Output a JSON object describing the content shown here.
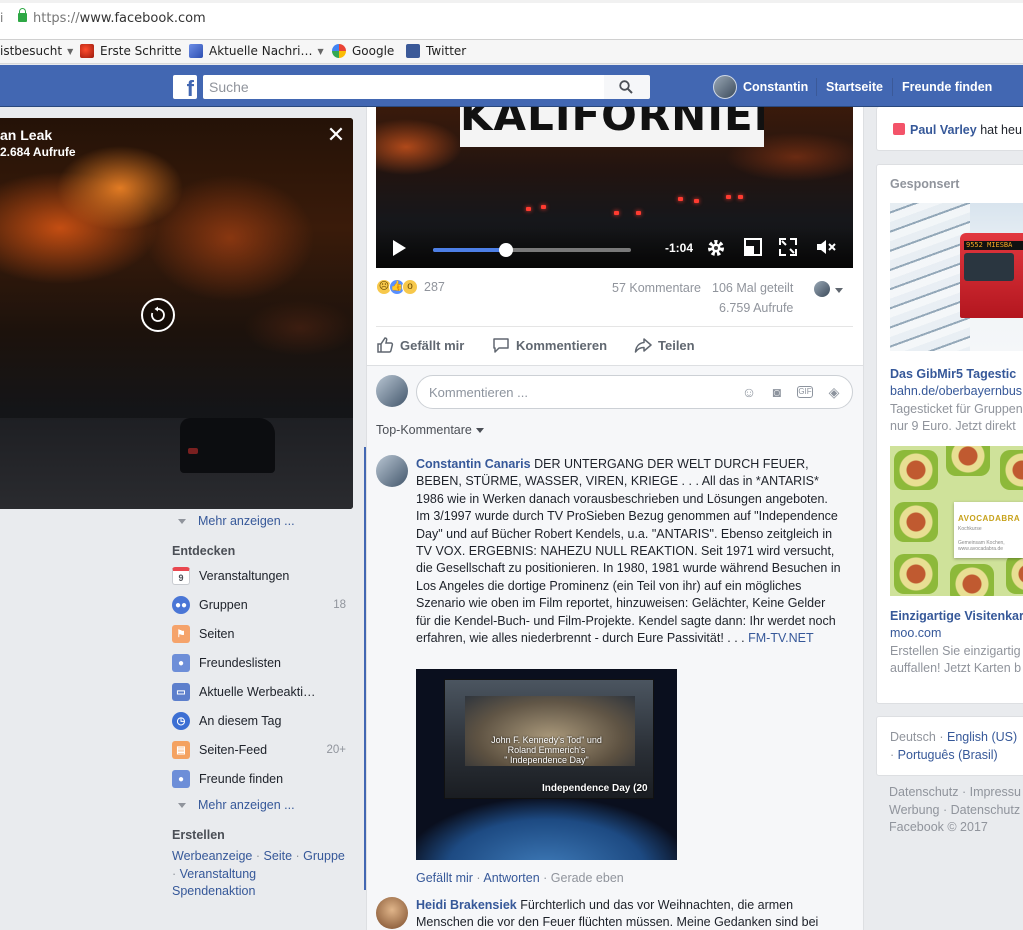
{
  "browser": {
    "url_prefix": "https://",
    "url_host": "www.facebook.com",
    "bookmarks": [
      {
        "label": "istbesucht",
        "caret": "▼"
      },
      {
        "label": "Erste Schritte"
      },
      {
        "label": "Aktuelle Nachri…",
        "caret": "▼"
      },
      {
        "label": "Google"
      },
      {
        "label": "Twitter"
      }
    ]
  },
  "topbar": {
    "logo": "f",
    "search_placeholder": "Suche",
    "user_name": "Constantin",
    "links": [
      "Startseite",
      "Freunde finden"
    ]
  },
  "left_video": {
    "title": "an Leak",
    "views": "2.684 Aufrufe",
    "close": "✕"
  },
  "left_nav": {
    "more_top": "Mehr anzeigen ...",
    "discover_heading": "Entdecken",
    "items": [
      {
        "label": "Veranstaltungen",
        "icon": "calendar-icon",
        "icon_text": "9",
        "count": ""
      },
      {
        "label": "Gruppen",
        "icon": "groups-icon",
        "count": "18"
      },
      {
        "label": "Seiten",
        "icon": "flag-icon",
        "count": ""
      },
      {
        "label": "Freundeslisten",
        "icon": "friends-list-icon",
        "count": ""
      },
      {
        "label": "Aktuelle Werbeakti…",
        "icon": "ads-icon",
        "count": ""
      },
      {
        "label": "An diesem Tag",
        "icon": "history-icon",
        "count": ""
      },
      {
        "label": "Seiten-Feed",
        "icon": "pages-feed-icon",
        "count": "20+"
      },
      {
        "label": "Freunde finden",
        "icon": "find-friends-icon",
        "count": ""
      }
    ],
    "more_bottom": "Mehr anzeigen ...",
    "create_heading": "Erstellen",
    "create_links": [
      "Werbeanzeige",
      "Seite",
      "Gruppe",
      "Veranstaltung",
      "Spendenaktion"
    ],
    "separator": "·"
  },
  "post": {
    "video_sign": "KALIFORNIEN",
    "video_time": "-1:04",
    "video_progress": 0.37,
    "reaction_count": "287",
    "comments": "57 Kommentare",
    "shares": "106 Mal geteilt",
    "views": "6.759 Aufrufe",
    "actions": {
      "like": "Gefällt mir",
      "comment": "Kommentieren",
      "share": "Teilen"
    },
    "comment_placeholder": "Kommentieren ...",
    "top_comments": "Top-Kommentare"
  },
  "comments": [
    {
      "author": "Constantin Canaris",
      "text": "DER UNTERGANG DER WELT DURCH FEUER, BEBEN, STÜRME, WASSER, VIREN, KRIEGE . . . All das in *ANTARIS* 1986 wie in Werken danach vorausbeschrieben und Lösungen angeboten. Im 3/1997 wurde durch TV ProSieben Bezug genommen auf \"Independence Day\" und auf Bücher Robert Kendels, u.a. \"ANTARIS\". Ebenso zeitgleich in TV VOX. ERGEBNIS: NAHEZU NULL REAKTION. Seit 1971 wird versucht, die Gesellschaft zu positionieren. In 1980, 1981 wurde während Besuchen in Los Angeles die dortige Prominenz (ein Teil von ihr) auf ein mögliches Szenario wie oben im Film reportet, hinzuweisen: Gelächter, Keine Gelder für die Kendel-Buch- und Film-Projekte. Kendel sagte dann: Ihr werdet noch erfahren, wie alles niederbrennt - durch Eure Passivität! . . .",
      "link": "FM-TV.NET",
      "image_lines": [
        "John F. Kennedy's Tod\" und",
        "Roland Emmerich's",
        "\" Independence Day\""
      ],
      "image_title": "Independence Day (20",
      "like": "Gefällt mir",
      "reply": "Antworten",
      "time": "Gerade eben",
      "sep": " · "
    },
    {
      "author": "Heidi Brakensiek",
      "text": "Fürchterlich und das vor Weihnachten, die armen Menschen die vor den Feuer flüchten müssen. Meine Gedanken sind bei"
    }
  ],
  "right": {
    "birthday_name": "Paul Varley",
    "birthday_text": "hat heu",
    "sponsored": "Gesponsert",
    "ads": [
      {
        "title": "Das GibMir5 Tagestic",
        "domain": "bahn.de/oberbayernbus",
        "text": [
          "Tagesticket für Gruppen",
          "nur 9 Euro. Jetzt direkt"
        ],
        "image_text": "9552 MIESBA"
      },
      {
        "title": "Einzigartige Visitenkar",
        "domain": "moo.com",
        "text": [
          "Erstellen Sie einzigartig",
          "auffallen! Jetzt Karten b"
        ],
        "image_text": "AVOCADABRA",
        "image_sub": "Kochkurse",
        "image_small": "Gemeinsam Kochen, www.avocadabra.de"
      }
    ],
    "languages": {
      "current": "Deutsch",
      "others": [
        "English (US)",
        "Português (Brasil)"
      ]
    },
    "footer": [
      "Datenschutz · Impressu",
      "Werbung · Datenschutz",
      "Facebook © 2017"
    ]
  }
}
